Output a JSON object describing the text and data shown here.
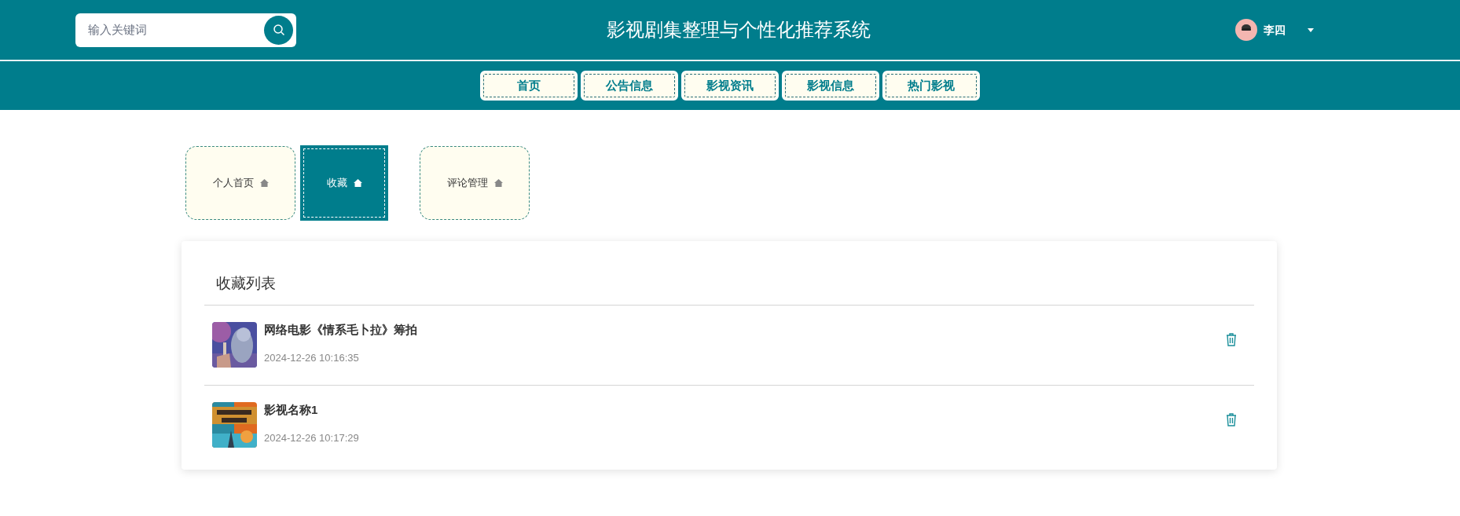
{
  "search": {
    "placeholder": "输入关键词"
  },
  "site_title": "影视剧集整理与个性化推荐系统",
  "user": {
    "name": "李四"
  },
  "nav": [
    {
      "label": "首页"
    },
    {
      "label": "公告信息"
    },
    {
      "label": "影视资讯"
    },
    {
      "label": "影视信息"
    },
    {
      "label": "热门影视"
    }
  ],
  "tabs": [
    {
      "label": "个人首页",
      "selected": false
    },
    {
      "label": "收藏",
      "selected": true
    },
    {
      "label": "评论管理",
      "selected": false
    }
  ],
  "favorites": {
    "title": "收藏列表",
    "items": [
      {
        "title": "网络电影《情系毛卜拉》筹拍",
        "time": "2024-12-26 10:16:35"
      },
      {
        "title": "影视名称1",
        "time": "2024-12-26 10:17:29"
      }
    ]
  }
}
